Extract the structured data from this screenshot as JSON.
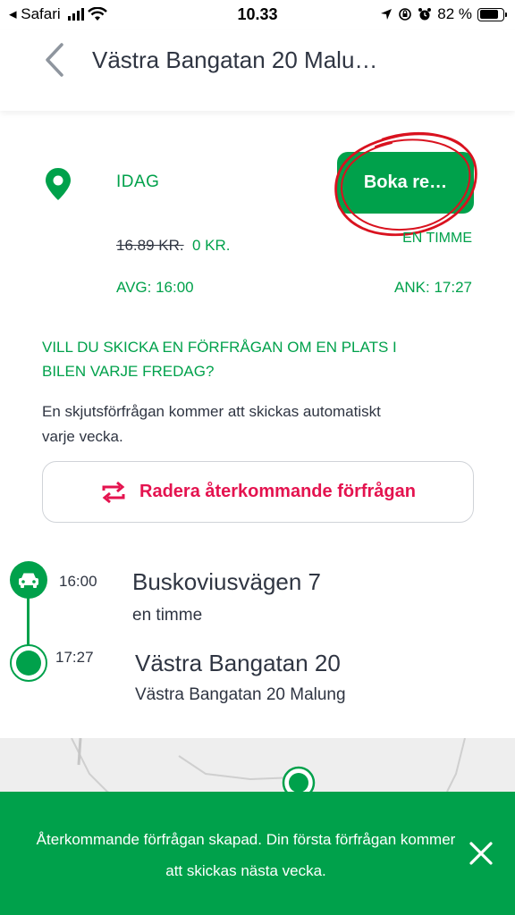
{
  "status_bar": {
    "back_app": "◂ Safari",
    "time": "10.33",
    "battery": "82 %",
    "battery_fraction": 0.82
  },
  "header": {
    "title": "Västra Bangatan 20 Malu…"
  },
  "trip": {
    "day": "IDAG",
    "book_label": "Boka re…",
    "price_old": "16.89 KR.",
    "price_new": "0 KR.",
    "duration": "EN TIMME",
    "departure": "AVG: 16:00",
    "arrival": "ANK: 17:27"
  },
  "recurring": {
    "question": "VILL DU SKICKA EN FÖRFRÅGAN OM EN PLATS I BILEN VARJE FREDAG?",
    "description": "En skjutsförfrågan kommer att skickas automatiskt varje vecka.",
    "delete_label": "Radera återkommande förfrågan"
  },
  "timeline": {
    "start_time": "16:00",
    "start_place": "Buskoviusvägen 7",
    "start_sub": "en timme",
    "end_time": "17:27",
    "end_place": "Västra Bangatan 20",
    "end_sub": "Västra Bangatan 20 Malung"
  },
  "toast": {
    "message": "Återkommande förfrågan skapad. Din första förfrågan kommer att skickas nästa vecka."
  },
  "colors": {
    "accent": "#00a14b",
    "danger": "#e4134f",
    "text": "#2f3542",
    "annotation": "#d9121f"
  }
}
